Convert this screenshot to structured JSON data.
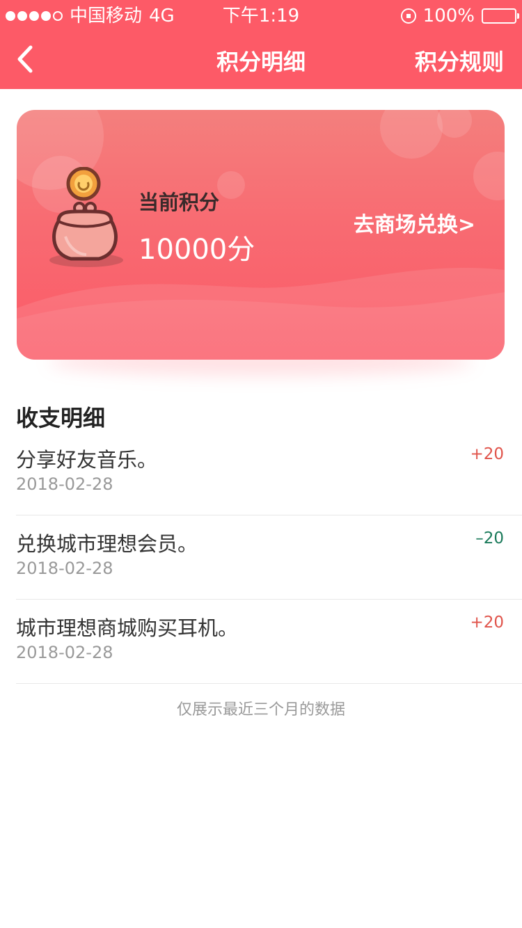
{
  "status_bar": {
    "carrier": "中国移动",
    "network": "4G",
    "time": "下午1:19",
    "battery": "100%"
  },
  "nav": {
    "title": "积分明细",
    "rules_label": "积分规则"
  },
  "points_card": {
    "label": "当前积分",
    "value": "10000分",
    "redeem_label": "去商场兑换>"
  },
  "section_title": "收支明细",
  "transactions": [
    {
      "title": "分享好友音乐。",
      "date": "2018-02-28",
      "amount": "+20"
    },
    {
      "title": "兑换城市理想会员。",
      "date": "2018-02-28",
      "amount": "–20"
    },
    {
      "title": "城市理想商城购买耳机。",
      "date": "2018-02-28",
      "amount": "+20"
    }
  ],
  "footer_note": "仅展示最近三个月的数据",
  "colors": {
    "brand": "#fd5a67",
    "plus": "#e0534a",
    "minus": "#1a7a5a"
  }
}
